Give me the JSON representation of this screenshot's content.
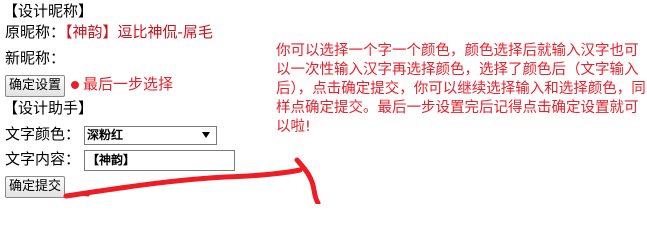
{
  "nickname_section": {
    "title": "【设计昵称】",
    "original_label": "原昵称：",
    "original_value": "【神韵】逗比神侃-屌毛",
    "new_label": "新昵称：",
    "confirm_button": "确定设置",
    "last_step_note": "最后一步选择"
  },
  "helper_section": {
    "title": "【设计助手】",
    "color_label": "文字颜色：",
    "color_selected": "深粉红",
    "content_label": "文字内容：",
    "content_value": "【神韵】",
    "submit_button": "确定提交"
  },
  "annotation": {
    "text": "你可以选择一个字一个颜色，颜色选择后就输入汉字也可以一次性输入汉字再选择颜色，选择了颜色后（文字输入后），点击确定提交，你可以继续选择输入和选择颜色，同样点确定提交。最后一步设置完后记得点击确定设置就可以啦!"
  },
  "colors": {
    "red_text": "#d0101a",
    "annotation_red": "#e8202a"
  }
}
